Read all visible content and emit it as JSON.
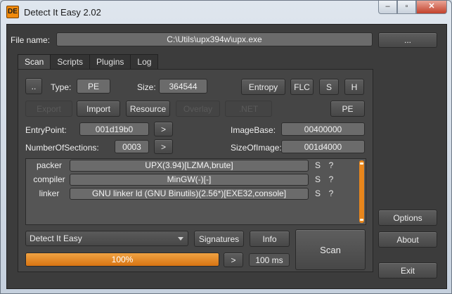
{
  "window": {
    "title": "Detect It Easy 2.02",
    "icon_text": "DE",
    "min": "–",
    "max": "▫",
    "close": "✕"
  },
  "file": {
    "label": "File name:",
    "value": "C:\\Utils\\upx394w\\upx.exe",
    "browse": "..."
  },
  "tabs": [
    {
      "label": "Scan"
    },
    {
      "label": "Scripts"
    },
    {
      "label": "Plugins"
    },
    {
      "label": "Log"
    }
  ],
  "scan": {
    "up": "..",
    "type_label": "Type:",
    "type_value": "PE",
    "size_label": "Size:",
    "size_value": "364544",
    "entropy": "Entropy",
    "flc": "FLC",
    "s": "S",
    "h": "H",
    "export": "Export",
    "import": "Import",
    "resource": "Resource",
    "overlay": "Overlay",
    "net": ".NET",
    "pe": "PE",
    "ep_label": "EntryPoint:",
    "ep_value": "001d19b0",
    "ib_label": "ImageBase:",
    "ib_value": "00400000",
    "nos_label": "NumberOfSections:",
    "nos_value": "0003",
    "soi_label": "SizeOfImage:",
    "soi_value": "001d4000",
    "arrow": ">"
  },
  "results": [
    {
      "type": "packer",
      "value": "UPX(3.94)[LZMA,brute]",
      "s": "S",
      "q": "?"
    },
    {
      "type": "compiler",
      "value": "MinGW(-)[-]",
      "s": "S",
      "q": "?"
    },
    {
      "type": "linker",
      "value": "GNU linker ld (GNU Binutils)(2.56*)[EXE32,console]",
      "s": "S",
      "q": "?"
    }
  ],
  "bottom": {
    "engine": "Detect It Easy",
    "signatures": "Signatures",
    "info": "Info",
    "scan": "Scan",
    "progress": 1.0,
    "progress_text": "100%",
    "arrow": ">",
    "time": "100 ms"
  },
  "side": {
    "options": "Options",
    "about": "About",
    "exit": "Exit"
  },
  "colors": {
    "accent": "#e8861c",
    "background": "#3c3c3c"
  }
}
